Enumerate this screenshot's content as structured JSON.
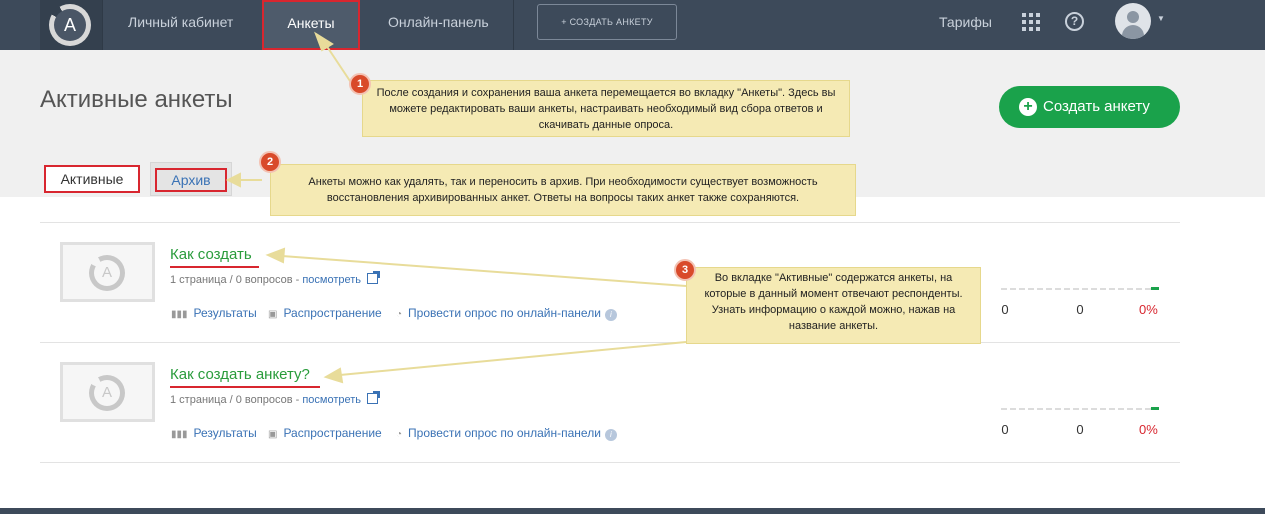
{
  "nav": {
    "logo_letter": "A",
    "items": [
      "Личный кабинет",
      "Анкеты",
      "Онлайн-панель"
    ],
    "create_label": "+ СОЗДАТЬ АНКЕТУ",
    "tariffs": "Тарифы",
    "help": "?"
  },
  "header": {
    "title": "Активные анкеты",
    "create_button": "Создать анкету",
    "plus": "+"
  },
  "tabs": {
    "active": "Активные",
    "archive": "Архив"
  },
  "tooltips": [
    {
      "num": "1",
      "text": "После создания и сохранения ваша анкета перемещается во вкладку \"Анкеты\". Здесь вы можете редактировать ваши анкеты, настраивать необходимый вид сбора ответов и скачивать данные опроса."
    },
    {
      "num": "2",
      "text": "Анкеты можно как удалять, так и переносить в архив. При необходимости существует возможность восстановления архивированных анкет. Ответы на вопросы таких анкет также сохраняются."
    },
    {
      "num": "3",
      "text": "Во вкладке \"Активные\" содержатся анкеты, на которые в данный момент отвечают респонденты. Узнать информацию о каждой можно, нажав на название анкеты."
    }
  ],
  "surveys": [
    {
      "title": "Как создать",
      "meta": "1 страница / 0 вопросов - ",
      "view": "посмотреть",
      "results": "Результаты",
      "distribution": "Распространение",
      "online": "Провести опрос по онлайн-панели",
      "stat1": "0",
      "stat2": "0",
      "percent": "0%",
      "thumb_letter": "A"
    },
    {
      "title": "Как создать анкету?",
      "meta": "1 страница / 0 вопросов - ",
      "view": "посмотреть",
      "results": "Результаты",
      "distribution": "Распространение",
      "online": "Провести опрос по онлайн-панели",
      "stat1": "0",
      "stat2": "0",
      "percent": "0%",
      "thumb_letter": "A"
    }
  ],
  "icons": {
    "results": "bar-chart-icon",
    "distribution": "share-icon",
    "online": "panel-icon",
    "info": "i"
  },
  "colors": {
    "nav_bg": "#3d4a5a",
    "accent_green": "#1aa24b",
    "highlight_red": "#d8262f",
    "tooltip_bg": "#f5eab4",
    "badge": "#d94a2a"
  }
}
